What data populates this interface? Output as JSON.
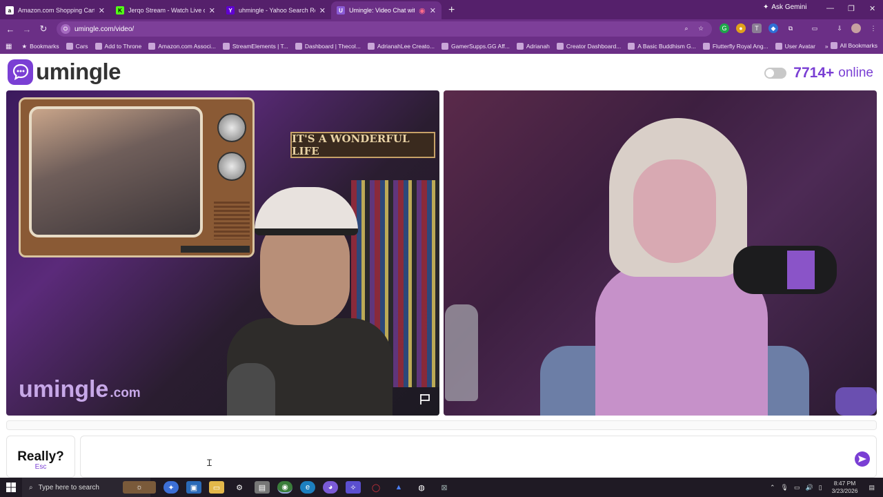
{
  "browser": {
    "tabs": [
      {
        "label": "Amazon.com Shopping Cart",
        "fav": "a",
        "fav_bg": "#ffffff",
        "fav_color": "#000000"
      },
      {
        "label": "Jerqo Stream - Watch Live on K",
        "fav": "K",
        "fav_bg": "#53fc18",
        "fav_color": "#000000"
      },
      {
        "label": "uhmingle - Yahoo Search Results",
        "fav": "Y",
        "fav_bg": "#6001d2",
        "fav_color": "#ffffff"
      },
      {
        "label": "Umingle: Video Chat with S",
        "fav": "U",
        "fav_bg": "#8a5bd6",
        "fav_color": "#ffffff"
      }
    ],
    "new_tab": "+",
    "ask_gemini": "Ask Gemini",
    "url": "umingle.com/video/",
    "bookmarks": [
      "Bookmarks",
      "Cars",
      "Add to Throne",
      "Amazon.com Associ...",
      "StreamElements | T...",
      "Dashboard | Thecol...",
      "AdrianahLee Creato...",
      "GamerSupps.GG Aff...",
      "Adrianah",
      "Creator Dashboard...",
      "A Basic Buddhism G...",
      "Flutterfly Royal Ang...",
      "User Avatar"
    ],
    "all_bookmarks": "All Bookmarks",
    "more_bookmarks": "»"
  },
  "page": {
    "logo_text": "umingle",
    "online_count": "7714+",
    "online_label": "online",
    "watermark_main": "umingle",
    "watermark_suffix": ".com",
    "sign_below": "IT'S A WONDERFUL LIFE",
    "stop_label": "Really?",
    "stop_hint": "Esc",
    "chat_placeholder": ""
  },
  "taskbar": {
    "search_placeholder": "Type here to search",
    "time": "8:47 PM",
    "date": "3/23/2026"
  },
  "colors": {
    "brand": "#7a3fd4",
    "chrome": "#6b2f86",
    "taskbar": "#1f1a24"
  }
}
